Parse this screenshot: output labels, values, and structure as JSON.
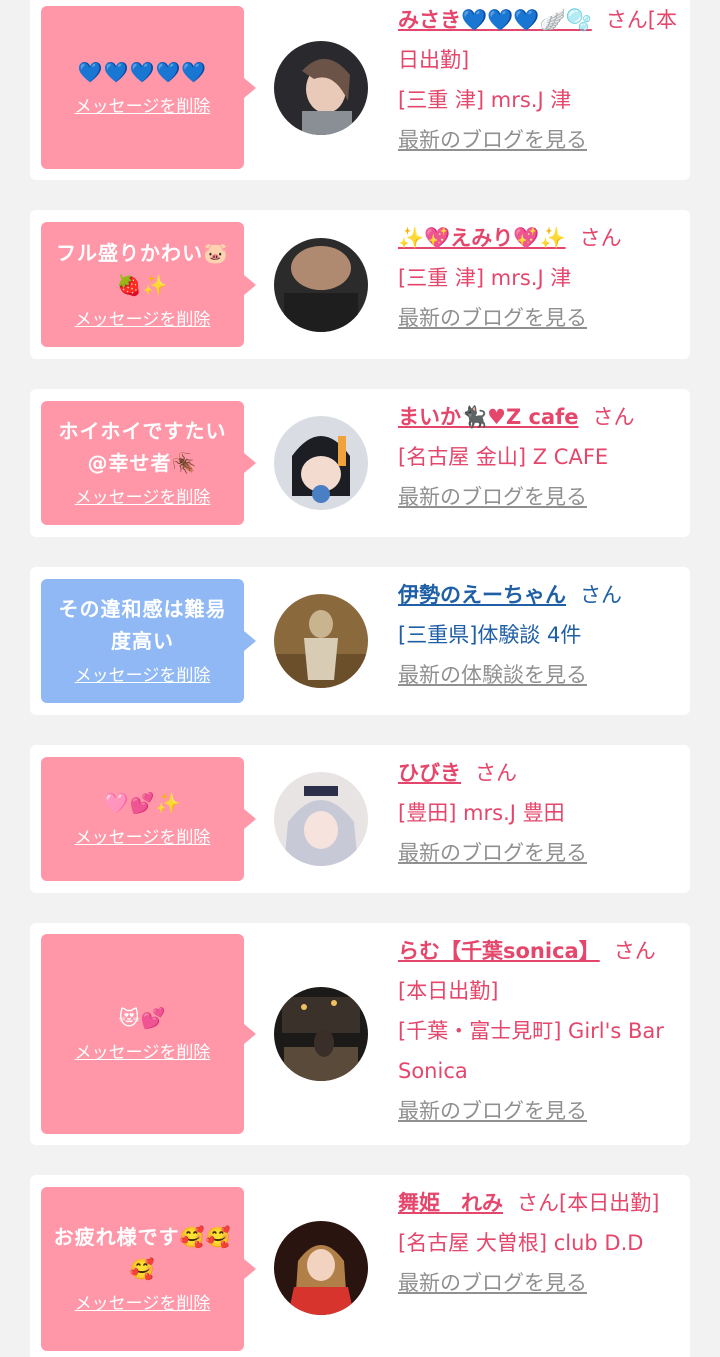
{
  "common": {
    "delete_label": "メッセージを削除",
    "san": "さん"
  },
  "items": [
    {
      "message": "💙💙💙💙💙",
      "name": "みさき💙💙💙🪽🫧",
      "status": "[本日出勤]",
      "shop": "[三重 津] mrs.J 津",
      "link": "最新のブログを見る"
    },
    {
      "message": "フル盛りかわい🐷🍓✨",
      "name": "✨💖えみり💖✨",
      "status": "",
      "shop": "[三重 津] mrs.J 津",
      "link": "最新のブログを見る"
    },
    {
      "message": "ホイホイですたい@幸せ者🪳",
      "name": "まいか🐈‍⬛♥Z cafe",
      "status": "",
      "shop": "[名古屋 金山] Z CAFE",
      "link": "最新のブログを見る"
    },
    {
      "message": "その違和感は難易度高い",
      "name": "伊勢のえーちゃん",
      "status": "",
      "shop": "[三重県]体験談 4件",
      "link": "最新の体験談を見る"
    },
    {
      "message": "🩷💕✨",
      "name": "ひびき",
      "status": "",
      "shop": "[豊田] mrs.J 豊田",
      "link": "最新のブログを見る"
    },
    {
      "message": "😻💕",
      "name": "らむ【千葉sonica】",
      "status": "[本日出勤]",
      "shop": "[千葉・富士見町] Girl's Bar Sonica",
      "link": "最新のブログを見る"
    },
    {
      "message": "お疲れ様です🥰🥰🥰",
      "name": "舞姫　れみ",
      "status": "[本日出勤]",
      "shop": "[名古屋 大曽根] club D.D",
      "link": "最新のブログを見る"
    }
  ]
}
